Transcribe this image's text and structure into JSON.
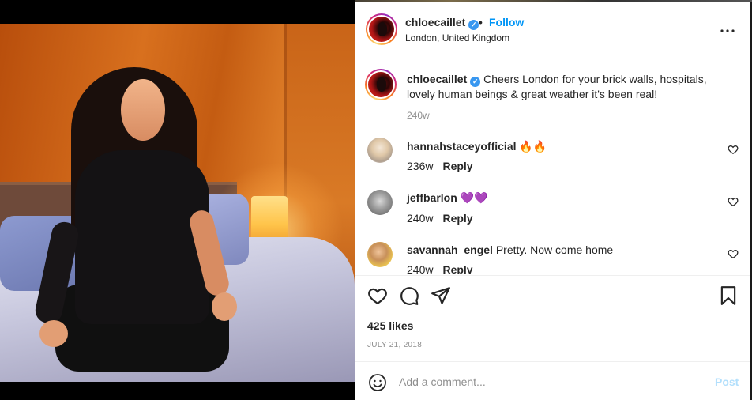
{
  "post": {
    "username": "chloecaillet",
    "location": "London, United Kingdom",
    "follow_label": "Follow",
    "separator": "•",
    "verified_glyph": "✓"
  },
  "caption": {
    "username": "chloecaillet",
    "text": "Cheers London for your brick walls, hospitals, lovely human beings & great weather it's been real!",
    "time": "240w"
  },
  "comments": [
    {
      "username": "hannahstaceyofficial",
      "text": "🔥🔥",
      "time": "236w",
      "reply_label": "Reply"
    },
    {
      "username": "jeffbarlon",
      "text": "💜💜",
      "time": "240w",
      "reply_label": "Reply"
    },
    {
      "username": "savannah_engel",
      "text": "Pretty. Now come home",
      "time": "240w",
      "reply_label": "Reply"
    }
  ],
  "stats": {
    "likes": "425 likes",
    "date": "JULY 21, 2018"
  },
  "composer": {
    "placeholder": "Add a comment...",
    "post_label": "Post"
  },
  "icons": [
    "more-options-icon",
    "heart-icon",
    "comment-icon",
    "share-icon",
    "bookmark-icon",
    "emoji-icon"
  ],
  "colors": {
    "accent": "#0095f6",
    "verified": "#3897f0",
    "post_disabled": "#b2dffc",
    "text": "#262626",
    "muted": "#8e8e8e"
  }
}
